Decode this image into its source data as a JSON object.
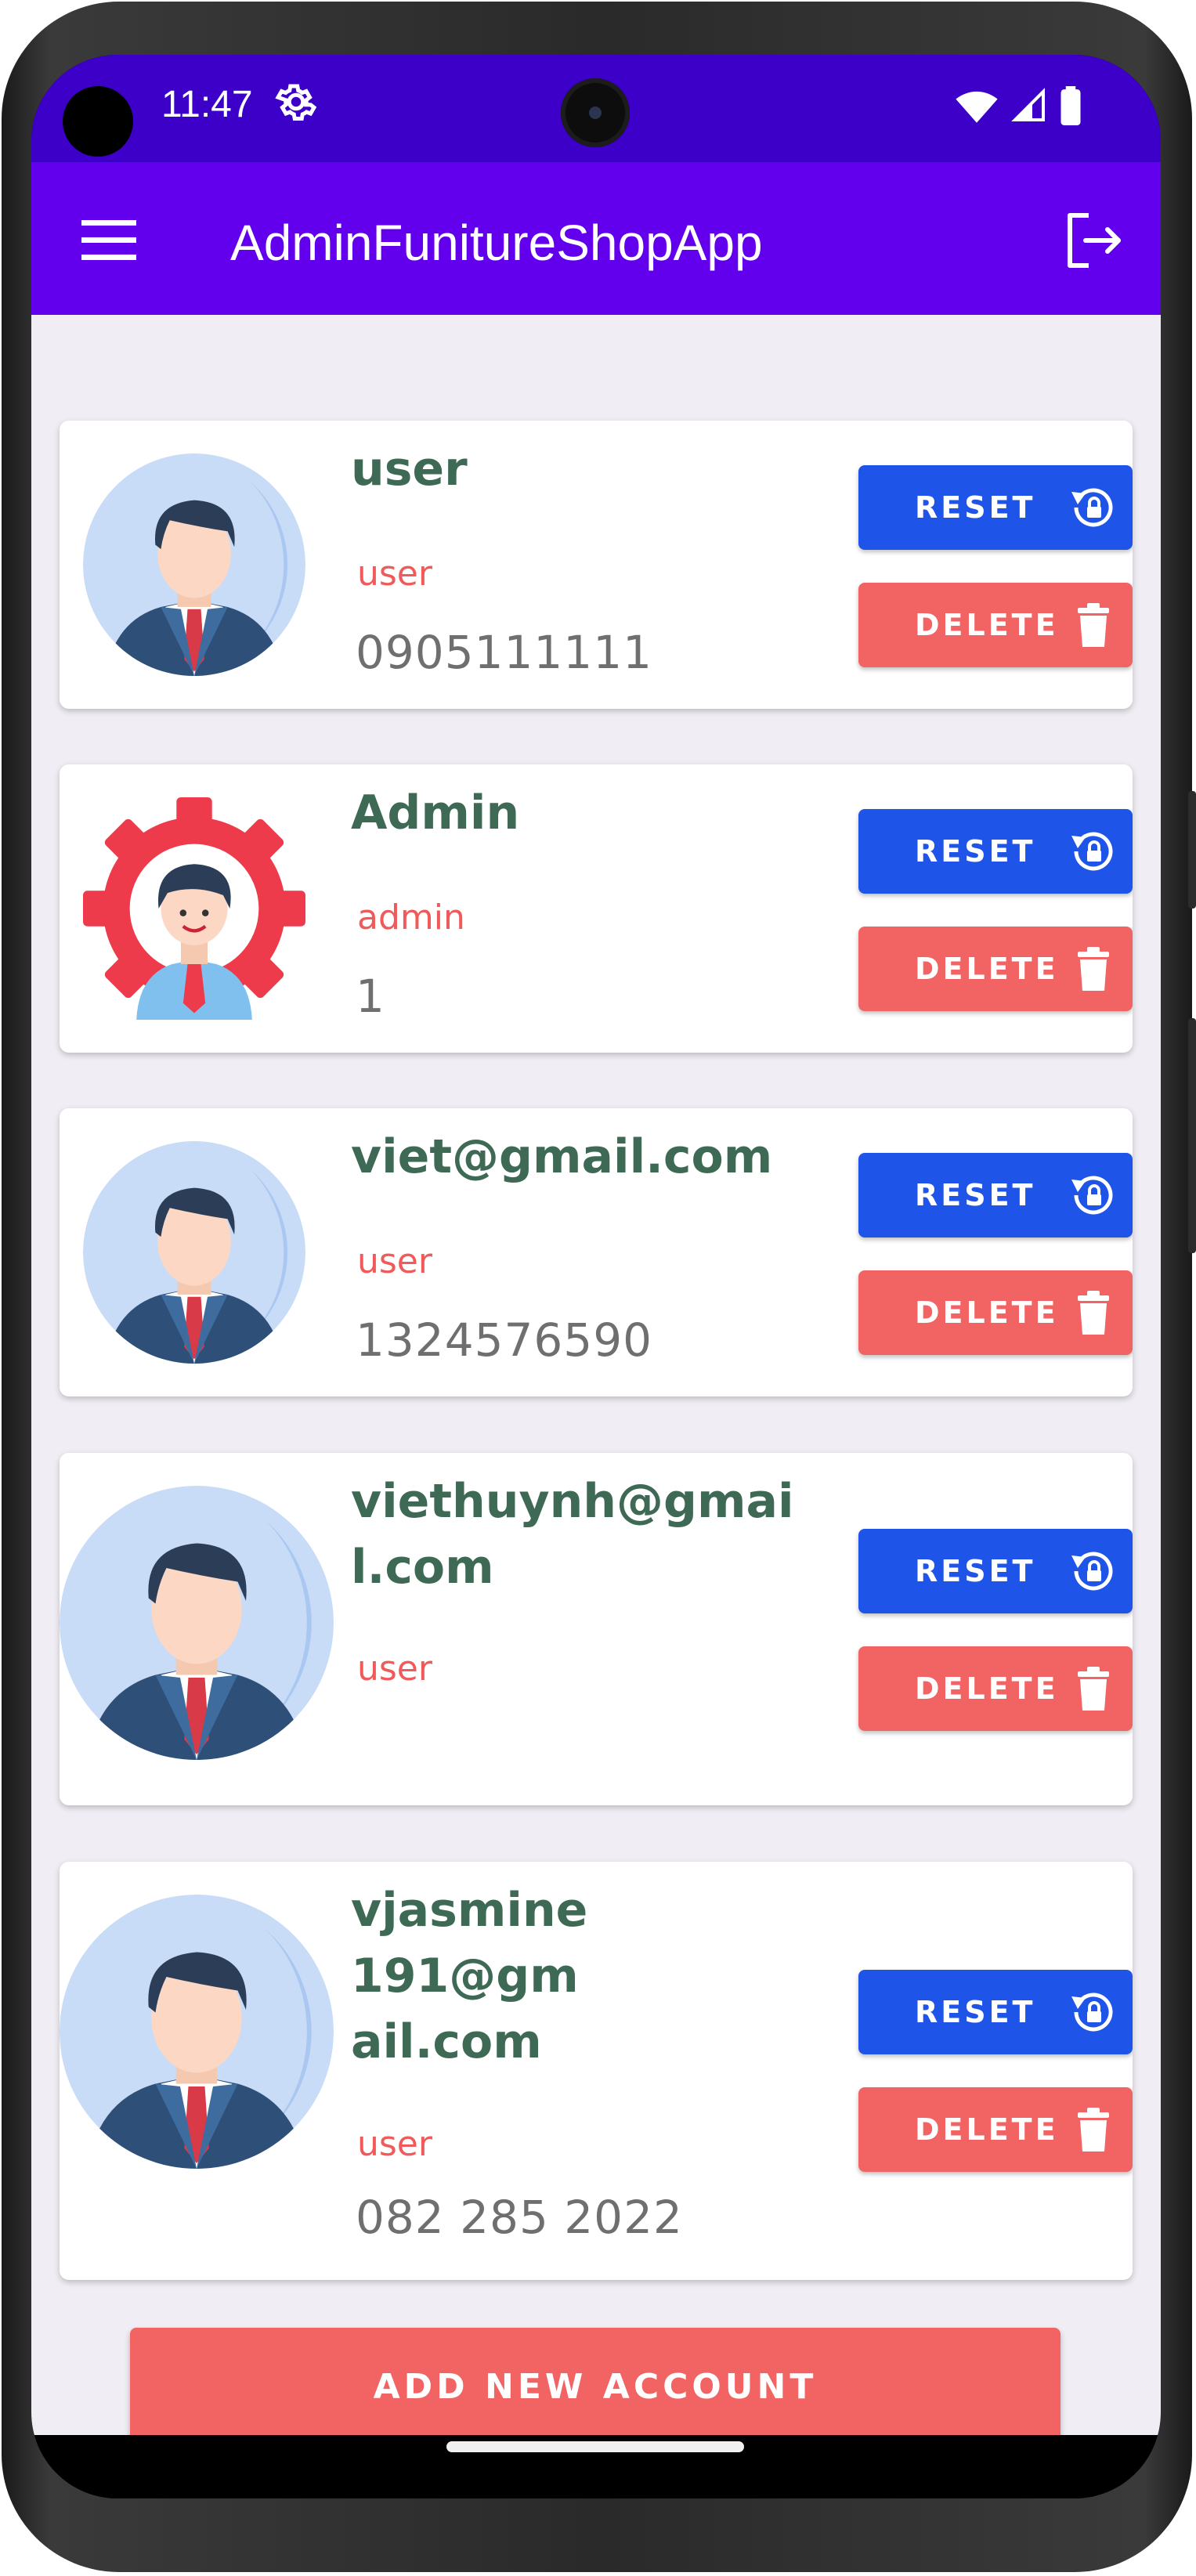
{
  "status_bar": {
    "time": "11:47"
  },
  "app_bar": {
    "title": "AdminFunitureShopApp"
  },
  "buttons": {
    "reset_label": "RESET",
    "delete_label": "DELETE",
    "add_label": "ADD NEW ACCOUNT"
  },
  "accounts": [
    {
      "name": "user",
      "role": "user",
      "phone": "0905111111",
      "avatar": "businessman-avatar-icon"
    },
    {
      "name": "Admin",
      "role": "admin",
      "phone": "1",
      "avatar": "admin-gear-avatar-icon"
    },
    {
      "name": "viet@gmail.com",
      "role": "user",
      "phone": "1324576590",
      "avatar": "businessman-avatar-icon"
    },
    {
      "name": "viethuynh@gmail.com",
      "role": "user",
      "phone": "",
      "avatar": "businessman-avatar-icon"
    },
    {
      "name": "vjasmine191@gmail.com",
      "role": "user",
      "phone": "082 285 2022",
      "avatar": "businessman-avatar-icon"
    }
  ],
  "colors": {
    "status_bar": "#3c00c9",
    "app_bar": "#6200ee",
    "background": "#f0eef4",
    "name_text": "#3e6a55",
    "role_text": "#f05a5a",
    "reset_button": "#1e55e8",
    "delete_button": "#f26463"
  }
}
